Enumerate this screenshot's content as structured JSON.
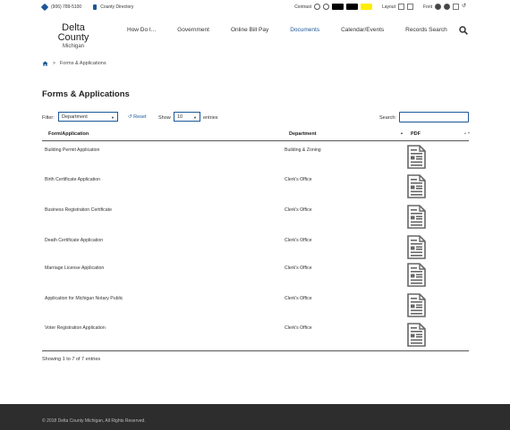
{
  "utility": {
    "phone": "(906) 789-5100",
    "directory": "County Directory",
    "contrast_label": "Contrast",
    "layout_label": "Layout",
    "font_label": "Font"
  },
  "logo": {
    "line1": "Delta County",
    "line2": "Michigan"
  },
  "nav": [
    {
      "label": "How Do I..."
    },
    {
      "label": "Government"
    },
    {
      "label": "Online Bill Pay"
    },
    {
      "label": "Documents"
    },
    {
      "label": "Calendar/Events"
    },
    {
      "label": "Records Search"
    }
  ],
  "breadcrumb": {
    "current": "Forms & Applications"
  },
  "page": {
    "title": "Forms & Applications"
  },
  "controls": {
    "filter_label": "Filter:",
    "filter_value": "Department",
    "reset_label": "Reset",
    "show_label": "Show",
    "show_value": "10",
    "entries_label": "entries",
    "search_label": "Search:"
  },
  "table": {
    "headers": [
      "Form/Application",
      "Department",
      "PDF"
    ],
    "rows": [
      {
        "form": "Building Permit Application",
        "dept": "Building & Zoning"
      },
      {
        "form": "Birth Certificate Application",
        "dept": "Clerk's Office"
      },
      {
        "form": "Business Registration Certificate",
        "dept": "Clerk's Office"
      },
      {
        "form": "Death Certificate Application",
        "dept": "Clerk's Office"
      },
      {
        "form": "Marriage License Application",
        "dept": "Clerk's Office"
      },
      {
        "form": "Application for Michigan Notary Public",
        "dept": "Clerk's Office"
      },
      {
        "form": "Voter Registration Application",
        "dept": "Clerk's Office"
      }
    ]
  },
  "info": "Showing 1 to 7 of 7 entries",
  "footer": {
    "copyright": "© 2018 Delta County Michigan, All Rights Reserved."
  },
  "colors": {
    "accent": "#1b5797",
    "footer_bg": "#2d2d2d",
    "highlight_yellow": "#ffed00"
  }
}
